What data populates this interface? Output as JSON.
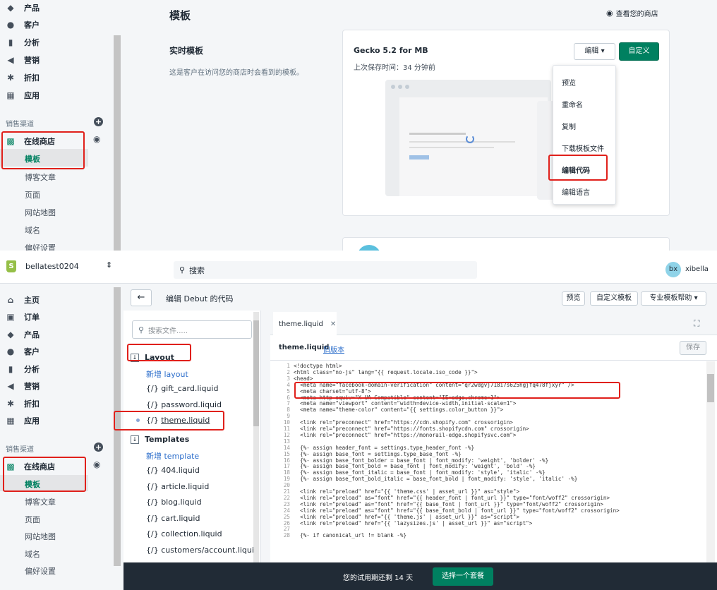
{
  "top": {
    "sidebar": {
      "items": [
        {
          "label": "产品",
          "icon": "tag-icon"
        },
        {
          "label": "客户",
          "icon": "person-icon"
        },
        {
          "label": "分析",
          "icon": "bar-chart-icon"
        },
        {
          "label": "营销",
          "icon": "megaphone-icon"
        },
        {
          "label": "折扣",
          "icon": "gear-discount-icon"
        },
        {
          "label": "应用",
          "icon": "apps-icon"
        }
      ],
      "section_label": "销售渠道",
      "channel": "在线商店",
      "sub_items": [
        "模板",
        "博客文章",
        "页面",
        "网站地图",
        "域名",
        "偏好设置"
      ]
    },
    "page_title": "模板",
    "view_store": "查看您的商店",
    "live_theme": {
      "heading": "实时模板",
      "description": "这是客户在访问您的商店时会看到的模板。",
      "theme_name": "Gecko 5.2 for MB",
      "saved": "上次保存时间：34 分钟前",
      "edit_button": "编辑",
      "customize_button": "自定义",
      "menu": [
        "预览",
        "重命名",
        "复制",
        "下载模板文件",
        "编辑代码",
        "编辑语言"
      ]
    }
  },
  "bottom": {
    "store_name": "bellatest0204",
    "search_placeholder": "搜索",
    "user": {
      "initials": "bx",
      "name": "xibella"
    },
    "sidebar": {
      "items": [
        {
          "label": "主页",
          "icon": "home-icon"
        },
        {
          "label": "订单",
          "icon": "orders-icon"
        },
        {
          "label": "产品",
          "icon": "tag-icon"
        },
        {
          "label": "客户",
          "icon": "person-icon"
        },
        {
          "label": "分析",
          "icon": "bar-chart-icon"
        },
        {
          "label": "营销",
          "icon": "megaphone-icon"
        },
        {
          "label": "折扣",
          "icon": "gear-discount-icon"
        },
        {
          "label": "应用",
          "icon": "apps-icon"
        }
      ],
      "section_label": "销售渠道",
      "channel": "在线商店",
      "sub_items": [
        "模板",
        "博客文章",
        "页面",
        "网站地图",
        "域名",
        "偏好设置"
      ]
    },
    "editor_title": "编辑 Debut 的代码",
    "header_buttons": [
      "预览",
      "自定义模板",
      "专业模板帮助"
    ],
    "file_search_placeholder": "搜索文件.....",
    "layout": {
      "heading": "Layout",
      "new": "新增 layout",
      "files": [
        "gift_card.liquid",
        "password.liquid",
        "theme.liquid"
      ]
    },
    "templates": {
      "heading": "Templates",
      "new": "新增 template",
      "files": [
        "404.liquid",
        "article.liquid",
        "blog.liquid",
        "cart.liquid",
        "collection.liquid",
        "customers/account.liquid"
      ]
    },
    "file_prefix": "{/}",
    "tab": "theme.liquid",
    "file_title": "theme.liquid",
    "old_version": "旧版本",
    "save": "保存",
    "trial_text": "您的试用期还剩 14 天",
    "trial_button": "选择一个套餐",
    "code": [
      "<!doctype html>",
      "<html class=\"no-js\" lang=\"{{ request.locale.iso_code }}\">",
      "<head>",
      "  <meta name=\"facebook-domain-verification\" content=\"qr2wdgvj718i7s625hgjfq478fjxyr\" />",
      "  <meta charset=\"utf-8\">",
      "  <meta http-equiv=\"X-UA-Compatible\" content=\"IE=edge,chrome=1\">",
      "  <meta name=\"viewport\" content=\"width=device-width,initial-scale=1\">",
      "  <meta name=\"theme-color\" content=\"{{ settings.color_button }}\">",
      "",
      "  <link rel=\"preconnect\" href=\"https://cdn.shopify.com\" crossorigin>",
      "  <link rel=\"preconnect\" href=\"https://fonts.shopifycdn.com\" crossorigin>",
      "  <link rel=\"preconnect\" href=\"https://monorail-edge.shopifysvc.com\">",
      "",
      "  {%- assign header_font = settings.type_header_font -%}",
      "  {%- assign base_font = settings.type_base_font -%}",
      "  {%- assign base_font_bolder = base_font | font_modify: 'weight', 'bolder' -%}",
      "  {%- assign base_font_bold = base_font | font_modify: 'weight', 'bold' -%}",
      "  {%- assign base_font_italic = base_font | font_modify: 'style', 'italic' -%}",
      "  {%- assign base_font_bold_italic = base_font_bold | font_modify: 'style', 'italic' -%}",
      "",
      "  <link rel=\"preload\" href=\"{{ 'theme.css' | asset_url }}\" as=\"style\">",
      "  <link rel=\"preload\" as=\"font\" href=\"{{ header_font | font_url }}\" type=\"font/woff2\" crossorigin>",
      "  <link rel=\"preload\" as=\"font\" href=\"{{ base_font | font_url }}\" type=\"font/woff2\" crossorigin>",
      "  <link rel=\"preload\" as=\"font\" href=\"{{ base_font_bold | font_url }}\" type=\"font/woff2\" crossorigin>",
      "  <link rel=\"preload\" href=\"{{ 'theme.js' | asset_url }}\" as=\"script\">",
      "  <link rel=\"preload\" href=\"{{ 'lazysizes.js' | asset_url }}\" as=\"script\">",
      "",
      "  {%- if canonical_url != blank -%}"
    ]
  },
  "colors": {
    "accent_green": "#008060",
    "highlight_red": "#e0201b",
    "link_blue": "#2c6ecb",
    "dark_bar": "#212b36"
  }
}
